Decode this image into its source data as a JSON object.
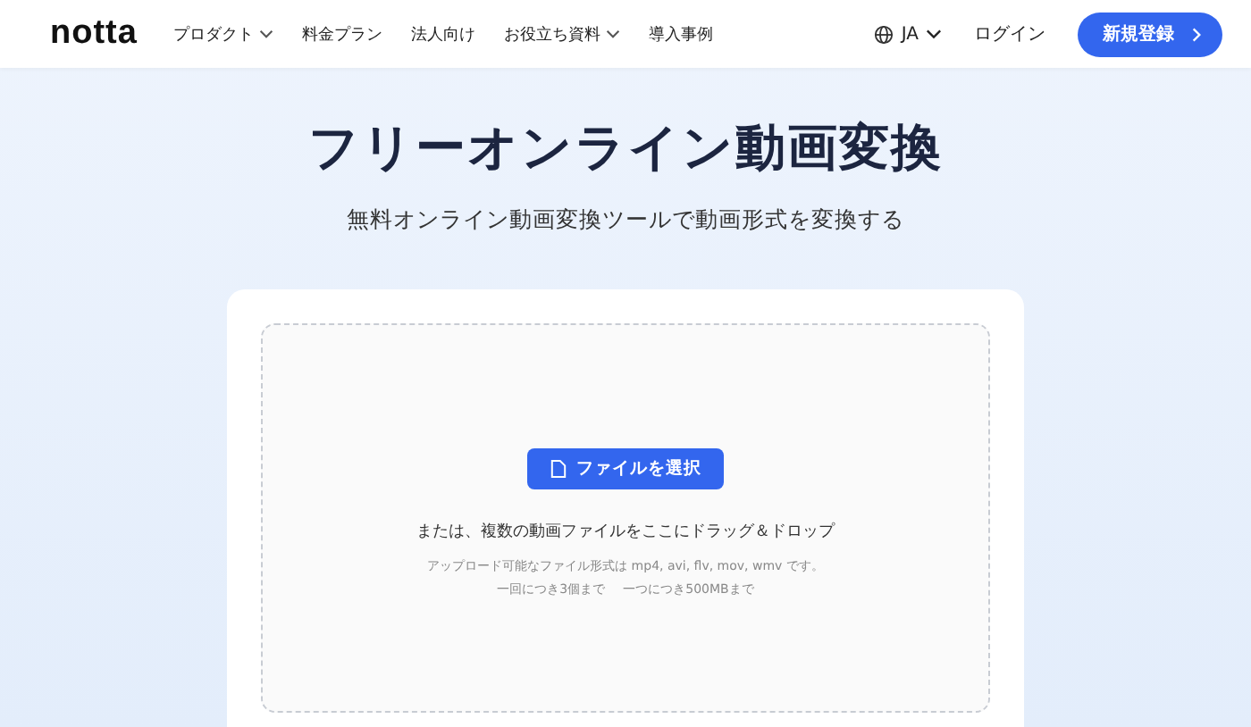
{
  "header": {
    "logo": "notta",
    "nav": [
      {
        "label": "プロダクト",
        "has_menu": true
      },
      {
        "label": "料金プラン",
        "has_menu": false
      },
      {
        "label": "法人向け",
        "has_menu": false
      },
      {
        "label": "お役立ち資料",
        "has_menu": true
      },
      {
        "label": "導入事例",
        "has_menu": false
      }
    ],
    "language": "JA",
    "login": "ログイン",
    "signup": "新規登録"
  },
  "hero": {
    "title": "フリーオンライン動画変換",
    "subtitle": "無料オンライン動画変換ツールで動画形式を変換する"
  },
  "upload": {
    "button": "ファイルを選択",
    "drop_hint": "または、複数の動画ファイルをここにドラッグ＆ドロップ",
    "formats": "アップロード可能なファイル形式は mp4, avi, flv, mov, wmv です。",
    "limits": [
      "一回につき3個まで",
      "一つにつき500MBまで"
    ]
  }
}
